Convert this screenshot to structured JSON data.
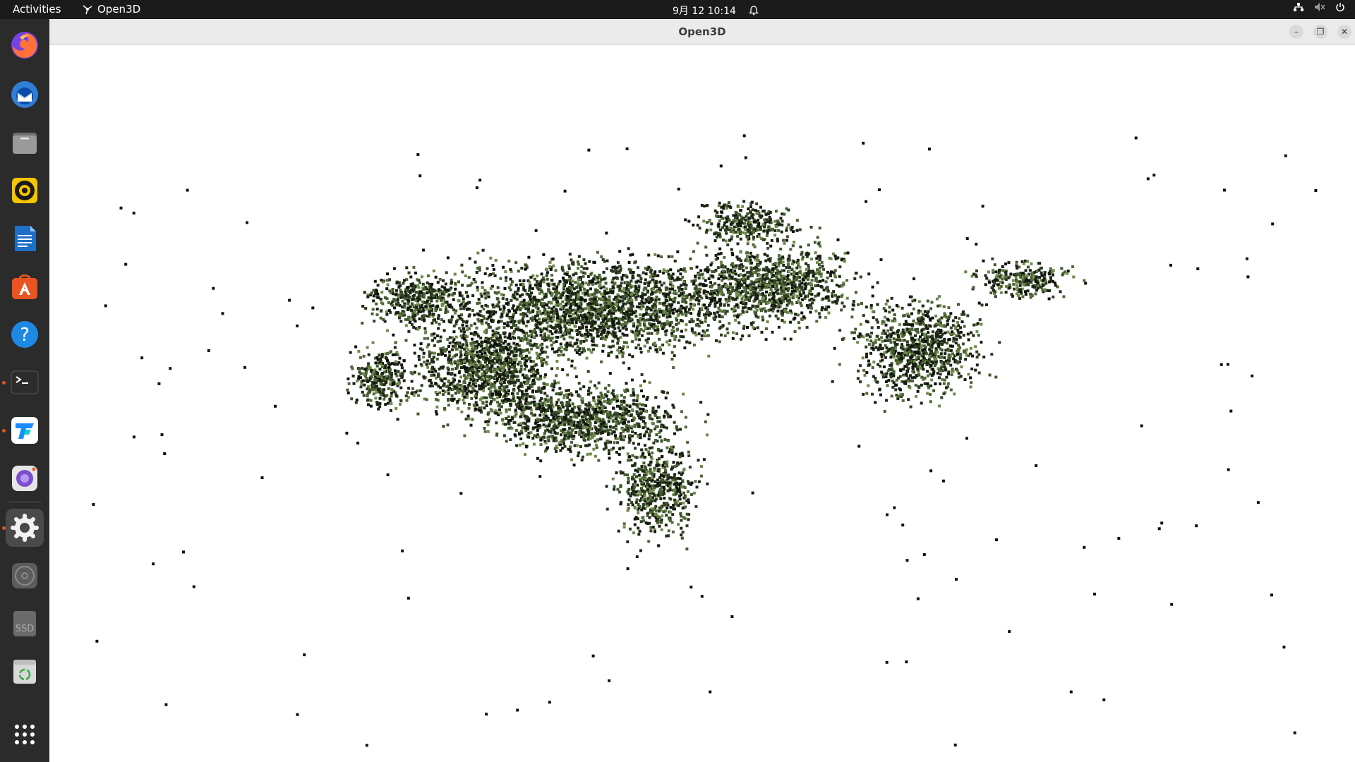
{
  "topbar": {
    "activities": "Activities",
    "app_name": "Open3D",
    "clock": "9月 12  10:14"
  },
  "dock": {
    "items": [
      {
        "name": "firefox-icon",
        "color": "#ff7139"
      },
      {
        "name": "thunderbird-icon",
        "color": "#2f7fd6"
      },
      {
        "name": "files-icon",
        "color": "#8a8a8a"
      },
      {
        "name": "rhythmbox-icon",
        "color": "#f5c400"
      },
      {
        "name": "writer-icon",
        "color": "#1e6fc6"
      },
      {
        "name": "app-center-icon",
        "color": "#e95420"
      },
      {
        "name": "help-icon",
        "color": "#1e88e5"
      },
      {
        "name": "terminal-icon",
        "color": "#2c2c2c"
      },
      {
        "name": "todesk-icon",
        "color": "#1a8cff"
      },
      {
        "name": "screenshot-icon",
        "color": "#7c4dcc"
      },
      {
        "name": "settings-icon",
        "color": "#9e9e9e"
      },
      {
        "name": "disc-icon",
        "color": "#8a8a8a"
      },
      {
        "name": "ssd-drive-icon",
        "color": "#9a9a9a",
        "label": "SSD"
      },
      {
        "name": "trash-icon",
        "color": "#cfcfcf"
      },
      {
        "name": "show-apps-icon",
        "color": "#ffffff"
      }
    ]
  },
  "window": {
    "title": "Open3D"
  },
  "colors": {
    "topbar": "#1b1b1b",
    "dock": "#2b2b2b",
    "accent": "#e95420",
    "viewport": "#ffffff",
    "point_dark": "#1c2414",
    "point_mid": "#3f5a2c",
    "point_light": "#6e8a4a"
  }
}
